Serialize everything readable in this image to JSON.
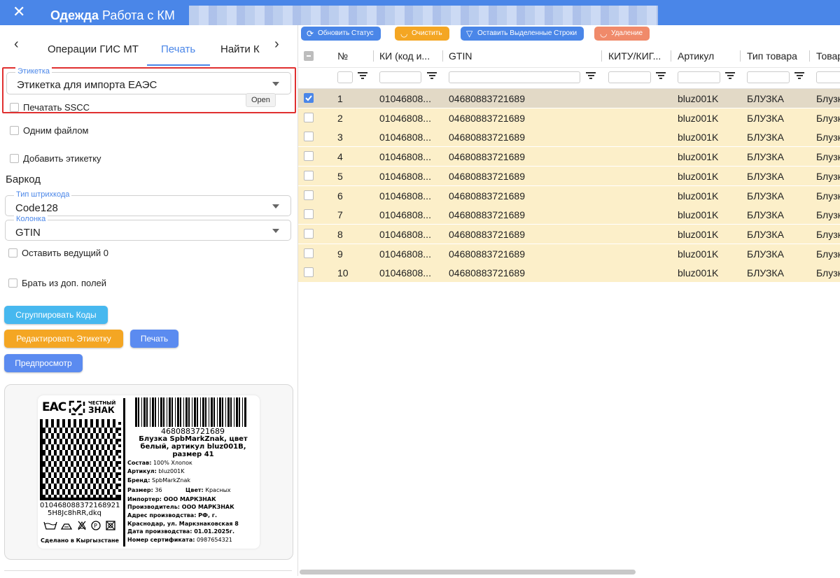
{
  "window": {
    "title_bold": "Одежда",
    "title_rest": " Работа с КМ"
  },
  "tabs": [
    "Операции ГИС МТ",
    "Печать",
    "Найти К"
  ],
  "active_tab": "Печать",
  "form": {
    "label_field": {
      "label": "Этикетка",
      "value": "Этикетка для импорта ЕАЭС"
    },
    "tooltip": "Open",
    "print_sscc": "Печатать SSCC",
    "one_file": "Одним файлом",
    "add_label": "Добавить этикетку",
    "barcode_section": "Баркод",
    "barcode_type": {
      "label": "Тип штрихкода",
      "value": "Code128"
    },
    "column": {
      "label": "Колонка",
      "value": "GTIN"
    },
    "keep_zero": "Оставить ведущий 0",
    "from_extra": "Брать из доп. полей"
  },
  "buttons": {
    "group_codes": "Сгруппировать Коды",
    "edit_label": "Редактировать Этикетку",
    "print": "Печать",
    "preview": "Предпросмотр"
  },
  "preview_label": {
    "eac": "ЕАС",
    "brand_mark_line1": "ЧЕСТНЫЙ",
    "brand_mark_line2": "ЗНАК",
    "barcode_number": "4680883721689",
    "product_title": "Блузка SpbMarkZnak, цвет белый, артикул bluz001B, размер 41",
    "composition_label": "Состав:",
    "composition": "100% Хлопок",
    "article_label": "Артикул:",
    "article": "bluz001K",
    "brand_label": "Бренд:",
    "brand": "SpbMarkZnak",
    "size_label": "Размер:",
    "size": "36",
    "color_label": "Цвет:",
    "color": "Красных",
    "importer": "Импортер: ООО МАРКЗНАК",
    "manufacturer": "Производитель: ООО МАРКЗНАК",
    "address1": "Адрес производства: РФ, г.",
    "address2": "Краснодар, ул. Маркзнаковская 8",
    "date": "Дата производства: 01.01.2025г.",
    "cert_label": "Номер сертификата:",
    "cert": "0987654321",
    "code_line1": "010468088372168921",
    "code_line2": "5H8Jc8hRR,dkq",
    "made_in": "Сделано в Кыргызстане"
  },
  "toolbar": {
    "refresh": "Обновить Статус",
    "clear": "Очистить",
    "keep_selected": "Оставить Выделенные Строки",
    "delete": "Удаление"
  },
  "colors": {
    "accent": "#4a86e8",
    "row_bg": "#fcefc9",
    "row_selected_bg": "#e2d9c6",
    "toolbar_orange": "#f4a623",
    "toolbar_red": "#f08a6a"
  },
  "table": {
    "columns": [
      "№",
      "КИ (код и...",
      "GTIN",
      "КИТУ/КИГ...",
      "Артикул",
      "Тип товара",
      "Товар"
    ],
    "rows": [
      {
        "n": "1",
        "ki": "01046808...",
        "gtin": "04680883721689",
        "article": "bluz001K",
        "type": "БЛУЗКА",
        "product": "Блузка",
        "checked": true
      },
      {
        "n": "2",
        "ki": "01046808...",
        "gtin": "04680883721689",
        "article": "bluz001K",
        "type": "БЛУЗКА",
        "product": "Блузка",
        "checked": false
      },
      {
        "n": "3",
        "ki": "01046808...",
        "gtin": "04680883721689",
        "article": "bluz001K",
        "type": "БЛУЗКА",
        "product": "Блузка",
        "checked": false
      },
      {
        "n": "4",
        "ki": "01046808...",
        "gtin": "04680883721689",
        "article": "bluz001K",
        "type": "БЛУЗКА",
        "product": "Блузка",
        "checked": false
      },
      {
        "n": "5",
        "ki": "01046808...",
        "gtin": "04680883721689",
        "article": "bluz001K",
        "type": "БЛУЗКА",
        "product": "Блузка",
        "checked": false
      },
      {
        "n": "6",
        "ki": "01046808...",
        "gtin": "04680883721689",
        "article": "bluz001K",
        "type": "БЛУЗКА",
        "product": "Блузка",
        "checked": false
      },
      {
        "n": "7",
        "ki": "01046808...",
        "gtin": "04680883721689",
        "article": "bluz001K",
        "type": "БЛУЗКА",
        "product": "Блузка",
        "checked": false
      },
      {
        "n": "8",
        "ki": "01046808...",
        "gtin": "04680883721689",
        "article": "bluz001K",
        "type": "БЛУЗКА",
        "product": "Блузка",
        "checked": false
      },
      {
        "n": "9",
        "ki": "01046808...",
        "gtin": "04680883721689",
        "article": "bluz001K",
        "type": "БЛУЗКА",
        "product": "Блузка",
        "checked": false
      },
      {
        "n": "10",
        "ki": "01046808...",
        "gtin": "04680883721689",
        "article": "bluz001K",
        "type": "БЛУЗКА",
        "product": "Блузка",
        "checked": false
      }
    ]
  }
}
